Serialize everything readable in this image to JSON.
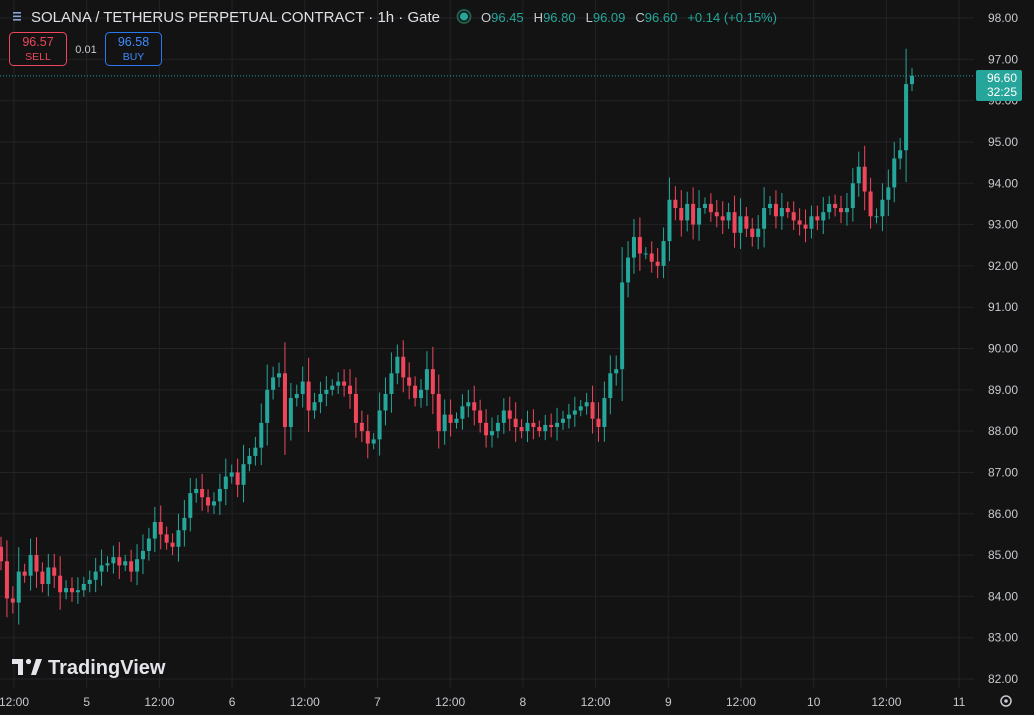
{
  "header": {
    "symbol_title": "SOLANA / TETHERUS PERPETUAL CONTRACT · 1h · Gate",
    "ohlc": [
      {
        "key": "O",
        "value": "96.45"
      },
      {
        "key": "H",
        "value": "96.80"
      },
      {
        "key": "L",
        "value": "96.09"
      },
      {
        "key": "C",
        "value": "96.60"
      }
    ],
    "change": "+0.14 (+0.15%)"
  },
  "trade": {
    "sell_price": "96.57",
    "sell_label": "SELL",
    "spread": "0.01",
    "buy_price": "96.58",
    "buy_label": "BUY"
  },
  "price_tag": {
    "price": "96.60",
    "countdown": "32:25"
  },
  "branding": {
    "logo_text": "TradingView"
  },
  "colors": {
    "up": "#26a69a",
    "down": "#f0465c",
    "background": "#131313",
    "sell": "#f0465c",
    "buy": "#2a78f0"
  },
  "chart_data": {
    "type": "candlestick",
    "interval": "1h",
    "ylim": [
      81.8,
      98.2
    ],
    "y_ticks": [
      "82.00",
      "83.00",
      "84.00",
      "85.00",
      "86.00",
      "87.00",
      "88.00",
      "89.00",
      "90.00",
      "91.00",
      "92.00",
      "93.00",
      "94.00",
      "95.00",
      "96.00",
      "97.00",
      "98.00"
    ],
    "x_ticks": [
      "12:00",
      "5",
      "12:00",
      "6",
      "12:00",
      "7",
      "12:00",
      "8",
      "12:00",
      "9",
      "12:00",
      "10",
      "12:00",
      "11"
    ],
    "last_price": 96.6,
    "closes": [
      84.85,
      83.95,
      83.85,
      84.6,
      84.5,
      85.0,
      84.6,
      84.3,
      84.7,
      84.5,
      84.1,
      84.2,
      84.1,
      84.15,
      84.3,
      84.4,
      84.6,
      84.75,
      84.8,
      84.95,
      84.75,
      84.85,
      84.6,
      84.9,
      85.1,
      85.4,
      85.8,
      85.5,
      85.3,
      85.2,
      85.6,
      85.9,
      86.5,
      86.6,
      86.4,
      86.2,
      86.3,
      86.6,
      86.9,
      87.0,
      86.7,
      87.2,
      87.4,
      87.6,
      88.2,
      89.0,
      89.3,
      89.4,
      88.1,
      88.8,
      88.9,
      89.2,
      88.5,
      88.7,
      88.9,
      89.0,
      89.1,
      89.2,
      89.1,
      88.9,
      88.2,
      88.0,
      87.7,
      87.8,
      88.5,
      88.9,
      89.4,
      89.8,
      89.3,
      89.1,
      88.8,
      89.0,
      89.5,
      88.9,
      88.0,
      88.4,
      88.2,
      88.3,
      88.6,
      88.7,
      88.5,
      88.2,
      87.9,
      88.0,
      88.2,
      88.5,
      88.3,
      88.1,
      88.0,
      88.2,
      88.1,
      88.0,
      88.15,
      88.1,
      88.2,
      88.3,
      88.4,
      88.5,
      88.6,
      88.7,
      88.3,
      88.1,
      88.8,
      89.4,
      89.5,
      91.6,
      92.2,
      92.7,
      92.3,
      92.3,
      92.1,
      92.0,
      92.6,
      93.6,
      93.4,
      93.1,
      93.5,
      93.0,
      93.4,
      93.5,
      93.3,
      93.2,
      93.1,
      93.3,
      92.8,
      93.2,
      92.9,
      92.7,
      92.9,
      93.4,
      93.5,
      93.2,
      93.4,
      93.3,
      93.1,
      93.0,
      92.9,
      93.2,
      93.1,
      93.3,
      93.5,
      93.4,
      93.3,
      93.4,
      94.0,
      94.4,
      93.8,
      93.2,
      93.2,
      93.6,
      93.9,
      94.6,
      94.8,
      96.4,
      96.6
    ]
  }
}
